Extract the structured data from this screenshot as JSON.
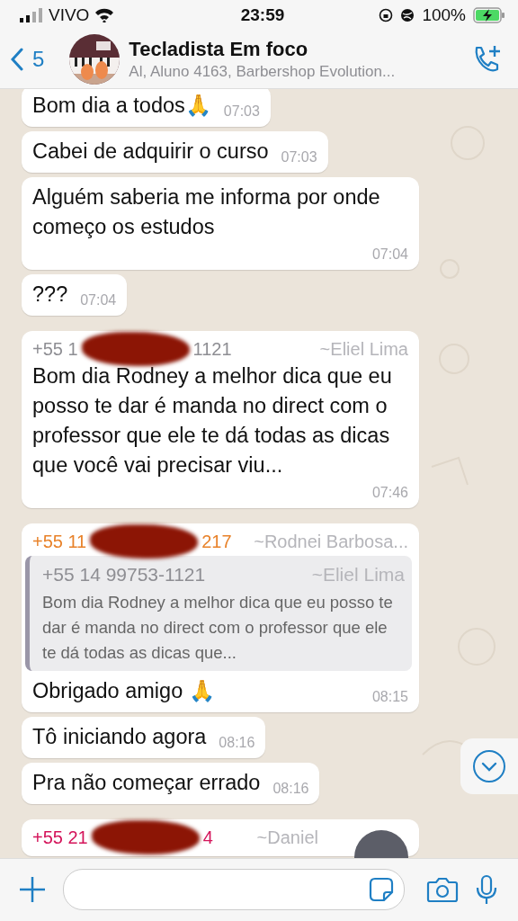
{
  "status_bar": {
    "carrier": "VIVO",
    "time": "23:59",
    "battery": "100%"
  },
  "header": {
    "back_count": "5",
    "title": "Tecladista Em foco",
    "subtitle": "Al, Aluno 4163, Barbershop Evolution..."
  },
  "messages": [
    {
      "kind": "text",
      "text": "Bom dia a todos🙏",
      "time": "07:03"
    },
    {
      "kind": "text",
      "text": "Cabei de adquirir o curso",
      "time": "07:03"
    },
    {
      "kind": "text",
      "text": "Alguém saberia me informa por onde começo os estudos",
      "time": "07:04"
    },
    {
      "kind": "text",
      "text": "???",
      "time": "07:04"
    },
    {
      "kind": "group",
      "sender": {
        "number_start": "+55 1",
        "number_end": "1121",
        "name": "~Eliel Lima",
        "color": "#8e8e93"
      },
      "text": "Bom dia Rodney a melhor dica que eu posso te dar é manda no direct com o professor que ele te dá todas as dicas que você vai precisar viu...",
      "time": "07:46"
    },
    {
      "kind": "reply",
      "sender": {
        "number_start": "+55 11",
        "number_end": "217",
        "name": "~Rodnei Barbosa...",
        "color": "#e8822a"
      },
      "quote": {
        "number": "+55 14 99753-1121",
        "name": "~Eliel Lima",
        "text": "Bom dia Rodney a melhor dica que eu posso te dar é manda no direct com o professor que ele te dá todas as dicas que..."
      },
      "text": "Obrigado amigo 🙏",
      "time": "08:15"
    },
    {
      "kind": "text",
      "text": "Tô iniciando agora",
      "time": "08:16"
    },
    {
      "kind": "text",
      "text": "Pra não começar errado",
      "time": "08:16"
    },
    {
      "kind": "group",
      "sender": {
        "number_start": "+55 21",
        "number_end": "4",
        "name": "~Daniel",
        "color": "#d4145a"
      }
    }
  ]
}
